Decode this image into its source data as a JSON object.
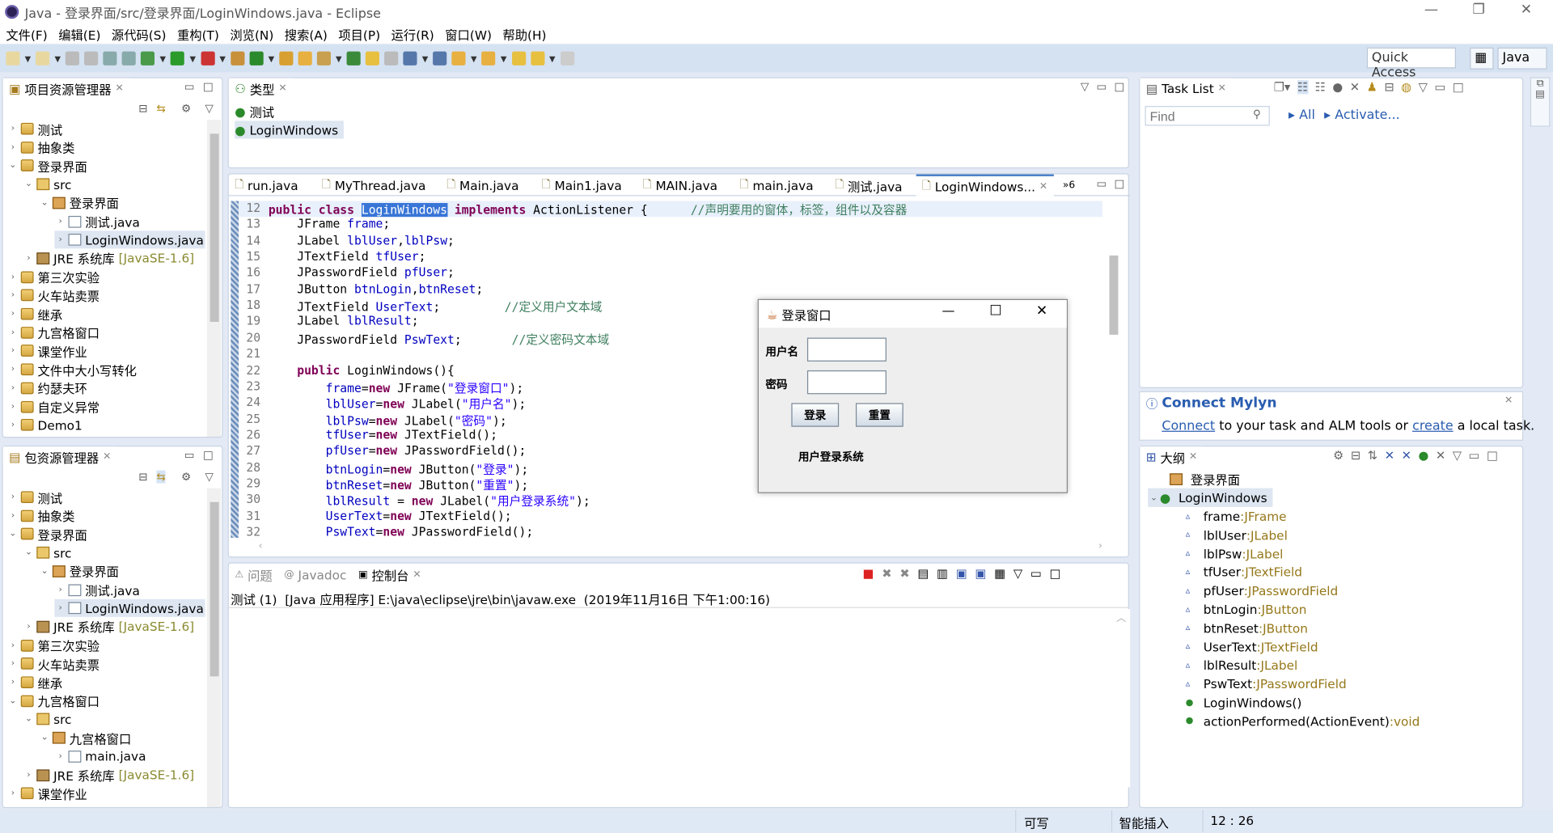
{
  "window": {
    "title": "Java  -  登录界面/src/登录界面/LoginWindows.java  -  Eclipse",
    "min": "—",
    "max": "❐",
    "close": "✕"
  },
  "menu": [
    "文件(F)",
    "编辑(E)",
    "源代码(S)",
    "重构(T)",
    "浏览(N)",
    "搜索(A)",
    "项目(P)",
    "运行(R)",
    "窗口(W)",
    "帮助(H)"
  ],
  "toolbar": {
    "quick_access": "Quick Access",
    "perspective": "Java"
  },
  "package_explorer_top": {
    "title": "项目资源管理器",
    "items": [
      {
        "lvl": 0,
        "tw": "›",
        "icon": "proj",
        "label": "测试"
      },
      {
        "lvl": 0,
        "tw": "›",
        "icon": "proj",
        "label": "抽象类"
      },
      {
        "lvl": 0,
        "tw": "⌄",
        "icon": "proj",
        "label": "登录界面"
      },
      {
        "lvl": 1,
        "tw": "⌄",
        "icon": "src",
        "label": "src"
      },
      {
        "lvl": 2,
        "tw": "⌄",
        "icon": "pkg",
        "label": "登录界面"
      },
      {
        "lvl": 3,
        "tw": "›",
        "icon": "java",
        "label": "测试.java"
      },
      {
        "lvl": 3,
        "tw": "›",
        "icon": "java",
        "label": "LoginWindows.java",
        "sel": true
      },
      {
        "lvl": 1,
        "tw": "›",
        "icon": "jre",
        "label": "JRE 系统库",
        "deco": "[JavaSE-1.6]"
      },
      {
        "lvl": 0,
        "tw": "›",
        "icon": "proj",
        "label": "第三次实验"
      },
      {
        "lvl": 0,
        "tw": "›",
        "icon": "proj",
        "label": "火车站卖票"
      },
      {
        "lvl": 0,
        "tw": "›",
        "icon": "proj",
        "label": "继承"
      },
      {
        "lvl": 0,
        "tw": "›",
        "icon": "proj",
        "label": "九宫格窗口"
      },
      {
        "lvl": 0,
        "tw": "›",
        "icon": "proj",
        "label": "课堂作业"
      },
      {
        "lvl": 0,
        "tw": "›",
        "icon": "proj",
        "label": "文件中大小写转化"
      },
      {
        "lvl": 0,
        "tw": "›",
        "icon": "proj",
        "label": "约瑟夫环"
      },
      {
        "lvl": 0,
        "tw": "›",
        "icon": "proj",
        "label": "自定义异常"
      },
      {
        "lvl": 0,
        "tw": "›",
        "icon": "proj",
        "label": "Demo1"
      }
    ]
  },
  "package_explorer_bottom": {
    "title": "包资源管理器",
    "items": [
      {
        "lvl": 0,
        "tw": "›",
        "icon": "proj",
        "label": "测试"
      },
      {
        "lvl": 0,
        "tw": "›",
        "icon": "proj",
        "label": "抽象类"
      },
      {
        "lvl": 0,
        "tw": "⌄",
        "icon": "proj",
        "label": "登录界面"
      },
      {
        "lvl": 1,
        "tw": "⌄",
        "icon": "src",
        "label": "src"
      },
      {
        "lvl": 2,
        "tw": "⌄",
        "icon": "pkg",
        "label": "登录界面"
      },
      {
        "lvl": 3,
        "tw": "›",
        "icon": "java",
        "label": "测试.java"
      },
      {
        "lvl": 3,
        "tw": "›",
        "icon": "java",
        "label": "LoginWindows.java",
        "sel": true
      },
      {
        "lvl": 1,
        "tw": "›",
        "icon": "jre",
        "label": "JRE 系统库",
        "deco": "[JavaSE-1.6]"
      },
      {
        "lvl": 0,
        "tw": "›",
        "icon": "proj",
        "label": "第三次实验"
      },
      {
        "lvl": 0,
        "tw": "›",
        "icon": "proj",
        "label": "火车站卖票"
      },
      {
        "lvl": 0,
        "tw": "›",
        "icon": "proj",
        "label": "继承"
      },
      {
        "lvl": 0,
        "tw": "⌄",
        "icon": "proj",
        "label": "九宫格窗口"
      },
      {
        "lvl": 1,
        "tw": "⌄",
        "icon": "src",
        "label": "src"
      },
      {
        "lvl": 2,
        "tw": "⌄",
        "icon": "pkg",
        "label": "九宫格窗口"
      },
      {
        "lvl": 3,
        "tw": "›",
        "icon": "java",
        "label": "main.java"
      },
      {
        "lvl": 1,
        "tw": "›",
        "icon": "jre",
        "label": "JRE 系统库",
        "deco": "[JavaSE-1.6]"
      },
      {
        "lvl": 0,
        "tw": "›",
        "icon": "proj",
        "label": "课堂作业"
      }
    ]
  },
  "hierarchy": {
    "title": "类型",
    "items": [
      "测试",
      "LoginWindows"
    ]
  },
  "editor": {
    "tabs": [
      "run.java",
      "MyThread.java",
      "Main.java",
      "Main1.java",
      "MAIN.java",
      "main.java",
      "测试.java",
      "LoginWindows..."
    ],
    "overflow": "»6",
    "lines": [
      {
        "n": "12",
        "t": [
          [
            "kw",
            "public class "
          ],
          [
            "hl",
            "LoginWindows"
          ],
          [
            "kw",
            " implements "
          ],
          [
            "p",
            "ActionListener {      "
          ],
          [
            "cm",
            "//声明要用的窗体，标签，组件以及容器"
          ]
        ]
      },
      {
        "n": "13",
        "t": [
          [
            "p",
            "    JFrame "
          ],
          [
            "fld",
            "frame"
          ],
          [
            "p",
            ";"
          ]
        ]
      },
      {
        "n": "14",
        "t": [
          [
            "p",
            "    JLabel "
          ],
          [
            "fld",
            "lblUser"
          ],
          [
            "p",
            ","
          ],
          [
            "fld",
            "lblPsw"
          ],
          [
            "p",
            ";"
          ]
        ]
      },
      {
        "n": "15",
        "t": [
          [
            "p",
            "    JTextField "
          ],
          [
            "fld",
            "tfUser"
          ],
          [
            "p",
            ";"
          ]
        ]
      },
      {
        "n": "16",
        "t": [
          [
            "p",
            "    JPasswordField "
          ],
          [
            "fld",
            "pfUser"
          ],
          [
            "p",
            ";"
          ]
        ]
      },
      {
        "n": "17",
        "t": [
          [
            "p",
            "    JButton "
          ],
          [
            "fld",
            "btnLogin"
          ],
          [
            "p",
            ","
          ],
          [
            "fld",
            "btnReset"
          ],
          [
            "p",
            ";"
          ]
        ]
      },
      {
        "n": "18",
        "t": [
          [
            "p",
            "    JTextField "
          ],
          [
            "fld",
            "UserText"
          ],
          [
            "p",
            ";         "
          ],
          [
            "cm",
            "//定义用户文本域"
          ]
        ]
      },
      {
        "n": "19",
        "t": [
          [
            "p",
            "    JLabel "
          ],
          [
            "fld",
            "lblResult"
          ],
          [
            "p",
            ";"
          ]
        ]
      },
      {
        "n": "20",
        "t": [
          [
            "p",
            "    JPasswordField "
          ],
          [
            "fld",
            "PswText"
          ],
          [
            "p",
            ";       "
          ],
          [
            "cm",
            "//定义密码文本域"
          ]
        ]
      },
      {
        "n": "21",
        "t": []
      },
      {
        "n": "22",
        "t": [
          [
            "p",
            "    "
          ],
          [
            "kw",
            "public"
          ],
          [
            "p",
            " LoginWindows(){"
          ]
        ]
      },
      {
        "n": "23",
        "t": [
          [
            "p",
            "        "
          ],
          [
            "fld",
            "frame"
          ],
          [
            "p",
            "="
          ],
          [
            "kw",
            "new"
          ],
          [
            "p",
            " JFrame("
          ],
          [
            "str",
            "\"登录窗口\""
          ],
          [
            "p",
            ");"
          ]
        ]
      },
      {
        "n": "24",
        "t": [
          [
            "p",
            "        "
          ],
          [
            "fld",
            "lblUser"
          ],
          [
            "p",
            "="
          ],
          [
            "kw",
            "new"
          ],
          [
            "p",
            " JLabel("
          ],
          [
            "str",
            "\"用户名\""
          ],
          [
            "p",
            ");"
          ]
        ]
      },
      {
        "n": "25",
        "t": [
          [
            "p",
            "        "
          ],
          [
            "fld",
            "lblPsw"
          ],
          [
            "p",
            "="
          ],
          [
            "kw",
            "new"
          ],
          [
            "p",
            " JLabel("
          ],
          [
            "str",
            "\"密码\""
          ],
          [
            "p",
            ");"
          ]
        ]
      },
      {
        "n": "26",
        "t": [
          [
            "p",
            "        "
          ],
          [
            "fld",
            "tfUser"
          ],
          [
            "p",
            "="
          ],
          [
            "kw",
            "new"
          ],
          [
            "p",
            " JTextField();"
          ]
        ]
      },
      {
        "n": "27",
        "t": [
          [
            "p",
            "        "
          ],
          [
            "fld",
            "pfUser"
          ],
          [
            "p",
            "="
          ],
          [
            "kw",
            "new"
          ],
          [
            "p",
            " JPasswordField();"
          ]
        ]
      },
      {
        "n": "28",
        "t": [
          [
            "p",
            "        "
          ],
          [
            "fld",
            "btnLogin"
          ],
          [
            "p",
            "="
          ],
          [
            "kw",
            "new"
          ],
          [
            "p",
            " JButton("
          ],
          [
            "str",
            "\"登录\""
          ],
          [
            "p",
            ");"
          ]
        ]
      },
      {
        "n": "29",
        "t": [
          [
            "p",
            "        "
          ],
          [
            "fld",
            "btnReset"
          ],
          [
            "p",
            "="
          ],
          [
            "kw",
            "new"
          ],
          [
            "p",
            " JButton("
          ],
          [
            "str",
            "\"重置\""
          ],
          [
            "p",
            ");"
          ]
        ]
      },
      {
        "n": "30",
        "t": [
          [
            "p",
            "        "
          ],
          [
            "fld",
            "lblResult"
          ],
          [
            "p",
            " = "
          ],
          [
            "kw",
            "new"
          ],
          [
            "p",
            " JLabel("
          ],
          [
            "str",
            "\"用户登录系统\""
          ],
          [
            "p",
            ");"
          ]
        ]
      },
      {
        "n": "31",
        "t": [
          [
            "p",
            "        "
          ],
          [
            "fld",
            "UserText"
          ],
          [
            "p",
            "="
          ],
          [
            "kw",
            "new"
          ],
          [
            "p",
            " JTextField();"
          ]
        ]
      },
      {
        "n": "32",
        "t": [
          [
            "p",
            "        "
          ],
          [
            "fld",
            "PswText"
          ],
          [
            "p",
            "="
          ],
          [
            "kw",
            "new"
          ],
          [
            "p",
            " JPasswordField();"
          ]
        ]
      }
    ]
  },
  "console": {
    "tabs": [
      "问题",
      "Javadoc",
      "控制台"
    ],
    "launch": "测试 (1)  [Java 应用程序] E:\\java\\eclipse\\jre\\bin\\javaw.exe  (2019年11月16日 下午1:00:16)"
  },
  "tasklist": {
    "title": "Task List",
    "find_placeholder": "Find",
    "all": "All",
    "activate": "Activate..."
  },
  "mylyn": {
    "title": "Connect Mylyn",
    "connect": "Connect",
    "text1": " to your task and ALM tools or ",
    "create": "create",
    "text2": " a local task."
  },
  "outline": {
    "title": "大纲",
    "package": "登录界面",
    "class": "LoginWindows",
    "members": [
      {
        "name": "frame",
        "type": "JFrame"
      },
      {
        "name": "lblUser",
        "type": "JLabel"
      },
      {
        "name": "lblPsw",
        "type": "JLabel"
      },
      {
        "name": "tfUser",
        "type": "JTextField"
      },
      {
        "name": "pfUser",
        "type": "JPasswordField"
      },
      {
        "name": "btnLogin",
        "type": "JButton"
      },
      {
        "name": "btnReset",
        "type": "JButton"
      },
      {
        "name": "UserText",
        "type": "JTextField"
      },
      {
        "name": "lblResult",
        "type": "JLabel"
      },
      {
        "name": "PswText",
        "type": "JPasswordField"
      },
      {
        "name": "LoginWindows()",
        "type": "",
        "method": true
      },
      {
        "name": "actionPerformed(ActionEvent)",
        "type": "void",
        "method": true
      }
    ]
  },
  "dialog": {
    "title": "登录窗口",
    "user_label": "用户名",
    "pwd_label": "密码",
    "login": "登录",
    "reset": "重置",
    "result": "用户登录系统"
  },
  "status": {
    "writable": "可写",
    "insert": "智能插入",
    "position": "12 : 26"
  }
}
